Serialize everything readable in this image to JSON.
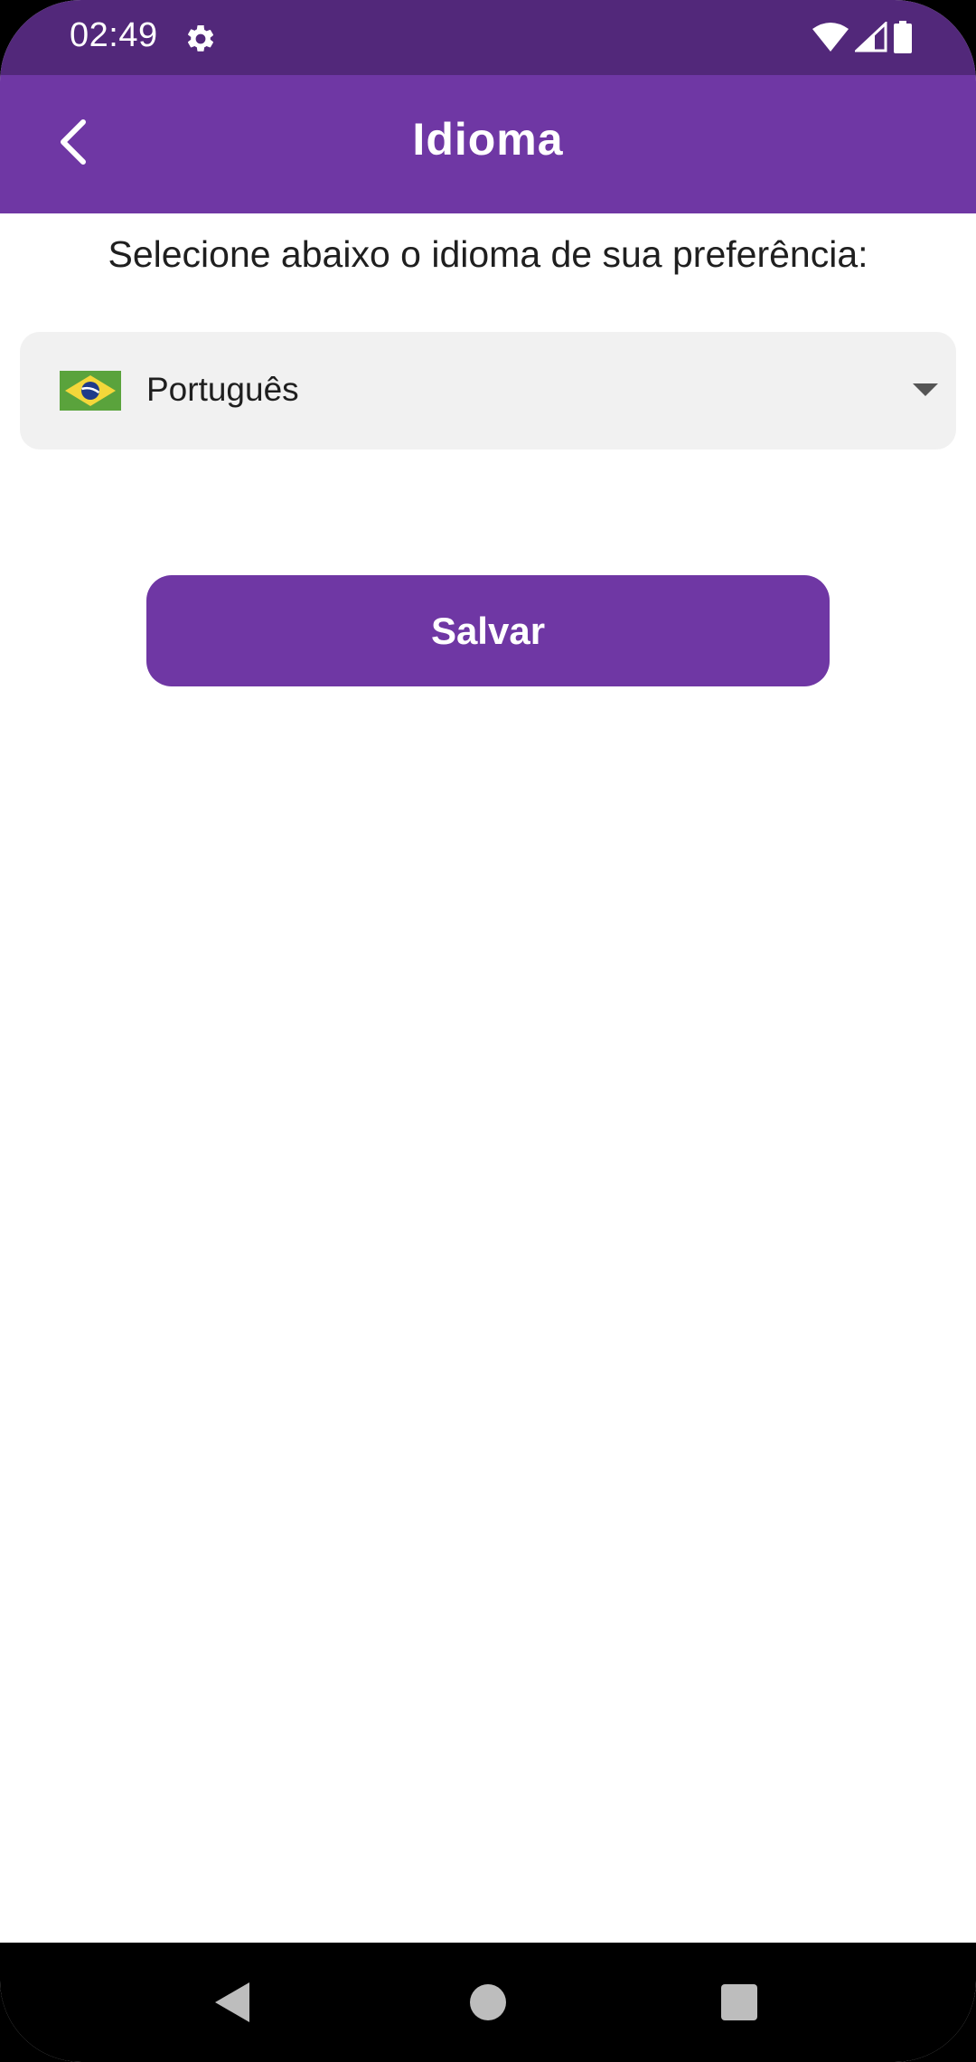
{
  "status_bar": {
    "time": "02:49",
    "icons": [
      "gear-icon",
      "wifi-icon",
      "signal-icon",
      "battery-icon"
    ]
  },
  "app_bar": {
    "title": "Idioma",
    "back_icon": "chevron-left-icon"
  },
  "main": {
    "instruction": "Selecione abaixo o idioma de sua preferência:",
    "language_select": {
      "selected_value": "Português",
      "flag_icon": "brazil-flag-icon"
    },
    "save_label": "Salvar"
  },
  "nav_bar": {
    "icons": [
      "triangle-back-icon",
      "circle-home-icon",
      "square-recents-icon"
    ]
  },
  "colors": {
    "status_bar": "#52287a",
    "primary": "#6f37a4",
    "select_background": "#f1f1f1",
    "text": "#1f1f1f"
  }
}
